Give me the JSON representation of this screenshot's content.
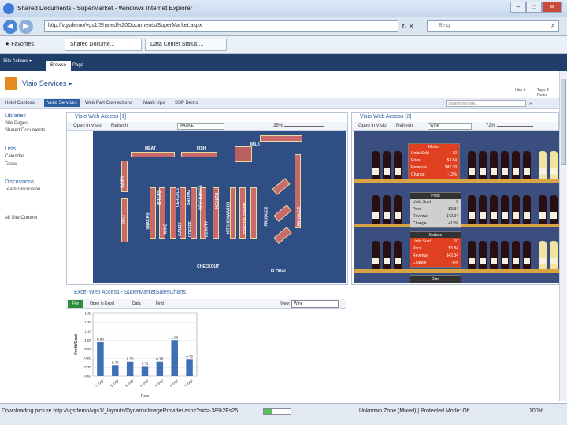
{
  "window": {
    "title": "Shared Documents - SuperMarket - Windows Internet Explorer",
    "url": "http://vgsdemo/vgs1/Shared%20Documents/SuperMarket.aspx",
    "search_placeholder": "Bing"
  },
  "favorites": {
    "label": "Favorites",
    "tabs": [
      "Shared Docume...",
      "Data Center Status ..."
    ]
  },
  "ribbon": {
    "site_actions": "Site Actions ▾",
    "tabs": [
      "Browse",
      "Page"
    ]
  },
  "site": {
    "title": "Visio Services ▸",
    "actions": [
      "Like It",
      "Tags & Notes"
    ]
  },
  "topnav": {
    "items": [
      "Hotel Contoso",
      "Visio Services",
      "Web Part Connections",
      "Mash Ups",
      "SSP Demo"
    ],
    "search_placeholder": "Search this site..."
  },
  "leftnav": {
    "libraries": "Libraries",
    "library_items": [
      "Site Pages",
      "Shared Documents"
    ],
    "lists": "Lists",
    "list_items": [
      "Calendar",
      "Tasks"
    ],
    "discussions": "Discussions",
    "discussion_items": [
      "Team Discussion"
    ],
    "all_content": "All Site Content"
  },
  "visio1": {
    "title": "Visio Web Access [1]",
    "open": "Open in Visio",
    "refresh": "Refresh",
    "page": "MARKET",
    "zoom": "35%",
    "aisles": [
      "MEAT",
      "FISH",
      "MILK",
      "DAIRY",
      "DELI",
      "SNACKS",
      "BREAD",
      "WINE",
      "CEREALS",
      "CANDY",
      "BAKING",
      "COFFEE",
      "BEVERAGES",
      "BEAUTY",
      "HEALTH",
      "KITCHENWARES",
      "FROZEN FOODS",
      "PRODUCE",
      "CHECKOUT",
      "FLORAL"
    ]
  },
  "visio2": {
    "title": "Visio Web Access [2]",
    "open": "Open in Visio",
    "refresh": "Refresh",
    "page": "Wine",
    "zoom": "72%",
    "callouts": [
      {
        "name": "Merlot",
        "rows": [
          [
            "Units Sold",
            "10"
          ],
          [
            "Price",
            "$3.84"
          ],
          [
            "Revenue",
            "$42.38"
          ],
          [
            "Change",
            "-13%"
          ]
        ]
      },
      {
        "name": "Pinot",
        "rows": [
          [
            "Units Sold",
            "6"
          ],
          [
            "Price",
            "$3.84"
          ],
          [
            "Revenue",
            "$42.34"
          ],
          [
            "Change",
            "+12%"
          ]
        ]
      },
      {
        "name": "Malbec",
        "rows": [
          [
            "Units Sold",
            "10"
          ],
          [
            "Price",
            "$3.84"
          ],
          [
            "Revenue",
            "$42.34"
          ],
          [
            "Change",
            "-8%"
          ]
        ]
      },
      {
        "name": "Dion",
        "rows": []
      }
    ]
  },
  "excel": {
    "title": "Excel Web Access - SuperMarketSalesCharts",
    "file": "File",
    "open": "Open in Excel",
    "data": "Data",
    "find": "Find",
    "view_label": "View:",
    "view_value": "Wine"
  },
  "chart_data": {
    "type": "bar",
    "categories": [
      "1-Sep",
      "2-Sep",
      "3-Sep",
      "4-Sep",
      "5-Sep",
      "6-Sep",
      "7-Sep"
    ],
    "values": [
      0.98,
      0.72,
      0.76,
      0.71,
      0.76,
      1.0,
      0.79
    ],
    "data_labels": [
      "0.98",
      "0.72",
      "0.76",
      "0.71",
      "0.76",
      "1.00",
      "0.79"
    ],
    "ylabel": "Profit/Cost",
    "xlabel": "Date",
    "ylim": [
      0.6,
      1.3
    ],
    "yticks": [
      "1.30",
      "1.20",
      "1.10",
      "1.00",
      "0.90",
      "0.80",
      "0.70",
      "0.60"
    ],
    "color": "#3f6fb5"
  },
  "status": {
    "text": "Downloading picture http://vgsdemo/vgs1/_layouts/DynamicImageProvider.aspx?sid=-38%2Es25",
    "zone": "Unknown Zone (Mixed) | Protected Mode: Off",
    "zoom": "100%"
  }
}
